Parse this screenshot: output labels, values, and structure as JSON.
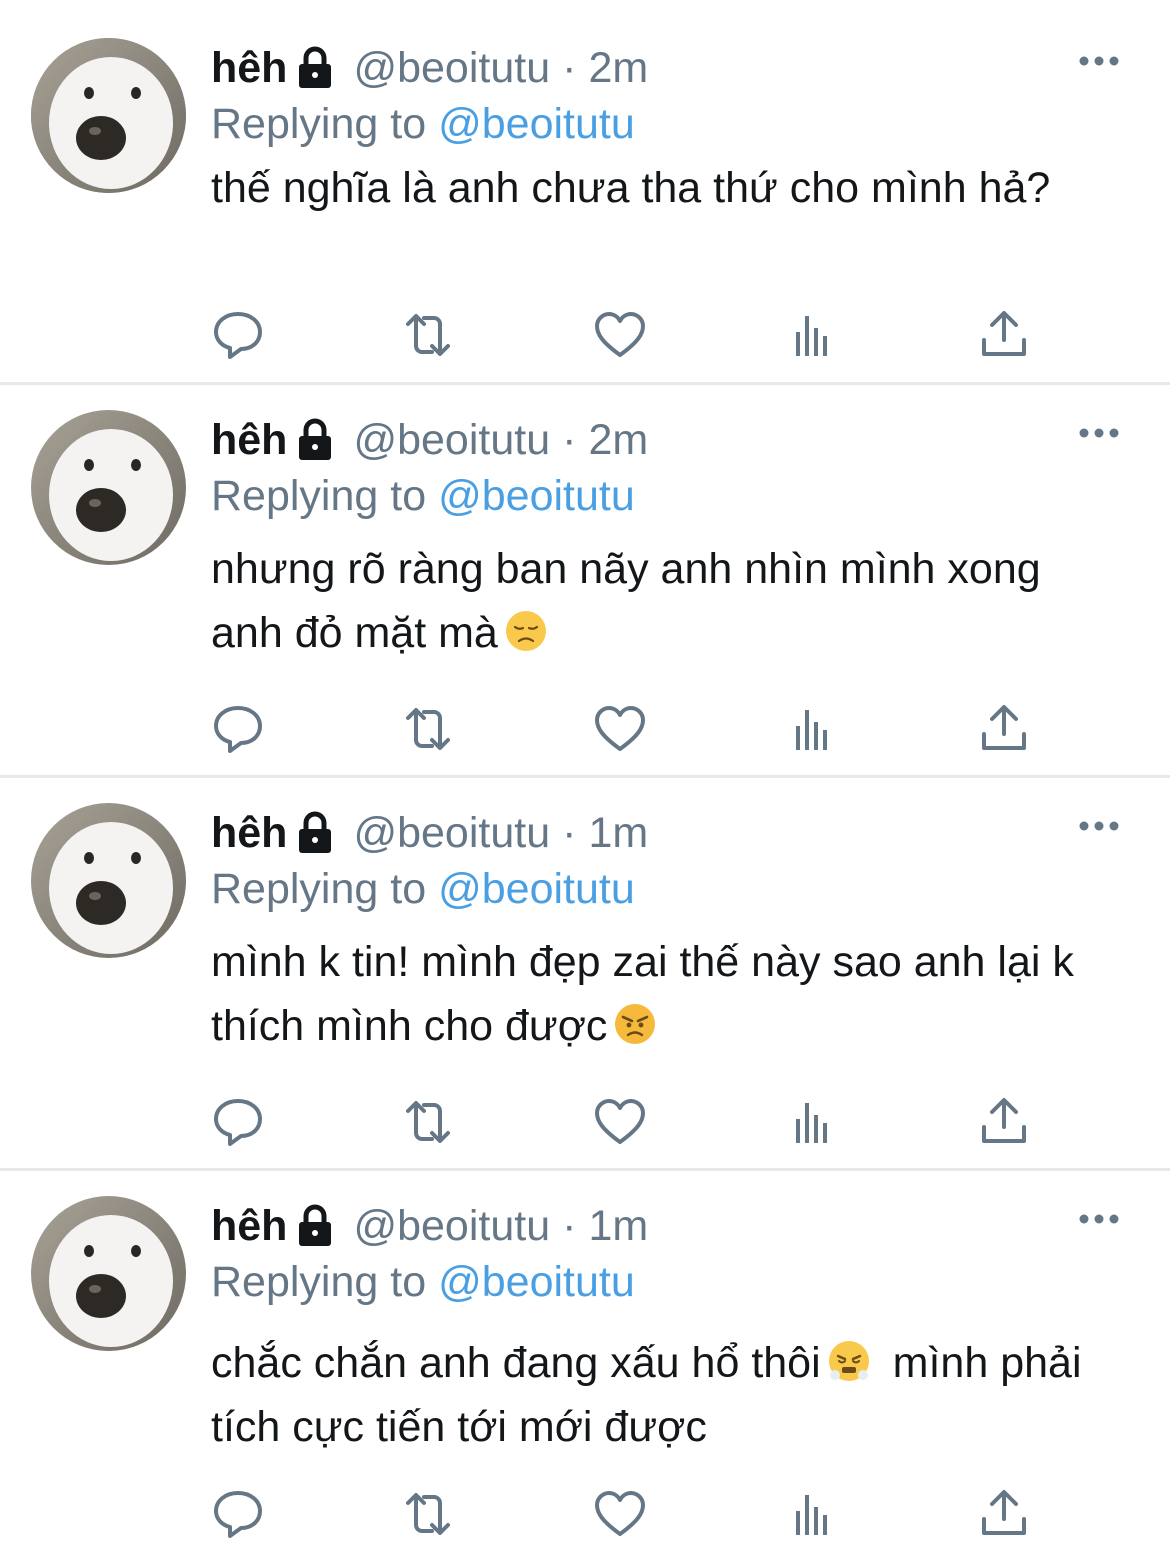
{
  "tweets": [
    {
      "name": "hêh",
      "handle": "@beoitutu",
      "separator": "·",
      "time": "2m",
      "reply_prefix": "Replying to",
      "reply_to": "@beoitutu",
      "text": "thế nghĩa là anh chưa tha thứ cho mình hả?",
      "emoji": ""
    },
    {
      "name": "hêh",
      "handle": "@beoitutu",
      "separator": "·",
      "time": "2m",
      "reply_prefix": "Replying to",
      "reply_to": "@beoitutu",
      "text": "nhưng rõ ràng ban nãy anh nhìn mình xong anh đỏ mặt mà",
      "emoji": "disappointed-face"
    },
    {
      "name": "hêh",
      "handle": "@beoitutu",
      "separator": "·",
      "time": "1m",
      "reply_prefix": "Replying to",
      "reply_to": "@beoitutu",
      "text": "mình k tin! mình đẹp zai thế này sao anh lại k thích mình cho được",
      "emoji": "angry-face"
    },
    {
      "name": "hêh",
      "handle": "@beoitutu",
      "separator": "·",
      "time": "1m",
      "reply_prefix": "Replying to",
      "reply_to": "@beoitutu",
      "text_before": "chắc chắn anh đang xấu hổ thôi",
      "text_after": "mình phải tích cực tiến tới mới được",
      "emoji": "face-with-steam-from-nose"
    }
  ],
  "icons": {
    "lock": "lock-icon",
    "more": "more-icon",
    "reply": "reply-icon",
    "retweet": "retweet-icon",
    "like": "heart-icon",
    "analytics": "analytics-icon",
    "share": "share-icon"
  },
  "colors": {
    "text": "#14171a",
    "secondary": "#657786",
    "link": "#4a9fe3",
    "divider": "#e6e8eb"
  }
}
